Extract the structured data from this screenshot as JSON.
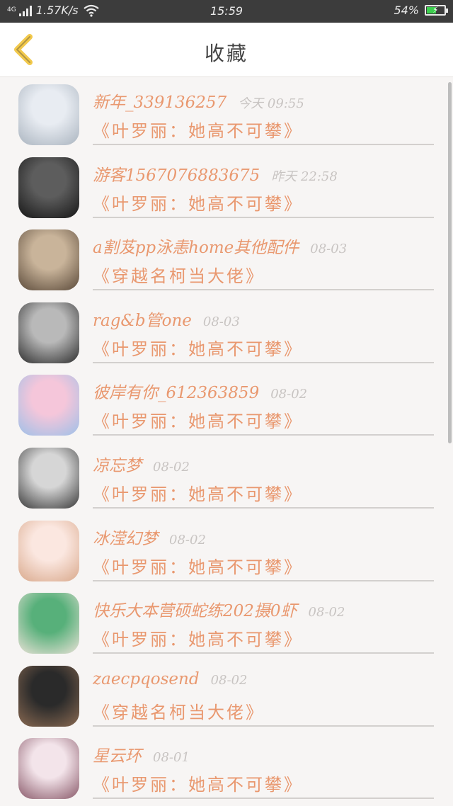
{
  "status_bar": {
    "network_type": "4G",
    "speed": "1.57K/s",
    "time": "15:59",
    "battery": "54%",
    "battery_level": 0.54
  },
  "header": {
    "title": "收藏",
    "back_icon": "chevron-left-icon",
    "accent_color": "#f2c94c"
  },
  "favorites": [
    {
      "user": "新年_339136257",
      "time": "今天 09:55",
      "book": "《叶罗丽：她高不可攀》",
      "avatar_colors": [
        "#e8ecf2",
        "#aab4bf"
      ]
    },
    {
      "user": "游客1567076883675",
      "time": "昨天 22:58",
      "book": "《叶罗丽：她高不可攀》",
      "avatar_colors": [
        "#5d5d5d",
        "#161616"
      ]
    },
    {
      "user": "a割芨pp泳恚home其他配件",
      "time": "08-03",
      "book": "《穿越名柯当大佬》",
      "avatar_colors": [
        "#c9b49a",
        "#5b4a3a"
      ]
    },
    {
      "user": "rag&b管one",
      "time": "08-03",
      "book": "《叶罗丽：她高不可攀》",
      "avatar_colors": [
        "#b9b9b9",
        "#2e2e2e"
      ]
    },
    {
      "user": "彼岸有你_612363859",
      "time": "08-02",
      "book": "《叶罗丽：她高不可攀》",
      "avatar_colors": [
        "#f5c6da",
        "#9ec0e8"
      ]
    },
    {
      "user": "凉忘梦",
      "time": "08-02",
      "book": "《叶罗丽：她高不可攀》",
      "avatar_colors": [
        "#d6d6d6",
        "#3a3a3a"
      ]
    },
    {
      "user": "冰滢幻梦",
      "time": "08-02",
      "book": "《叶罗丽：她高不可攀》",
      "avatar_colors": [
        "#fbe7e0",
        "#d9a98c"
      ]
    },
    {
      "user": "快乐大本营硕蛇练202摄0虾",
      "time": "08-02",
      "book": "《叶罗丽：她高不可攀》",
      "avatar_colors": [
        "#57b07a",
        "#e9e1d6"
      ]
    },
    {
      "user": "zaecpqosend",
      "time": "08-02",
      "book": "《穿越名柯当大佬》",
      "avatar_colors": [
        "#2a2a2a",
        "#8a6a52"
      ]
    },
    {
      "user": "星云环",
      "time": "08-01",
      "book": "《叶罗丽：她高不可攀》",
      "avatar_colors": [
        "#f3e4ea",
        "#8a5a6a"
      ]
    }
  ]
}
